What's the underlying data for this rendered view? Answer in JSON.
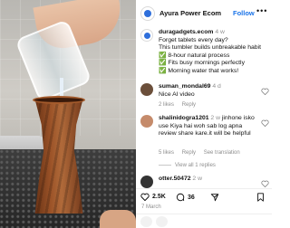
{
  "header": {
    "account": "Ayura Power Ecom",
    "follow_label": "Follow",
    "more_label": "•••"
  },
  "caption": {
    "username": "duragadgets.ecom",
    "time": "4 w",
    "lines": [
      "Forget tablets every day?",
      "This tumbler builds unbreakable habit",
      "✅ 8-hour natural process",
      "✅ Fits busy mornings perfectly",
      "✅ Morning water that works!"
    ]
  },
  "comments": [
    {
      "username": "suman_mondal69",
      "time": "4 d",
      "text": "Nice AI video",
      "likes": "2 likes",
      "reply": "Reply",
      "avatar_color": "#6b4f3a"
    },
    {
      "username": "shalinidogra1201",
      "time": "2 w",
      "text": "jinhone isko use Kiya hai woh sab log apna review share kare.it will be helpful",
      "likes": "5 likes",
      "reply": "Reply",
      "translation": "See translation",
      "avatar_color": "#c58b6b"
    },
    {
      "username": "otter.50472",
      "time": "2 w",
      "avatar_color": "#333333"
    }
  ],
  "view_replies": "View all 1 replies",
  "actions": {
    "likes": "2.5K",
    "comments": "36"
  },
  "date": "7 March",
  "colors": {
    "accent": "#1a73e8",
    "muted": "#8e8e8e"
  }
}
